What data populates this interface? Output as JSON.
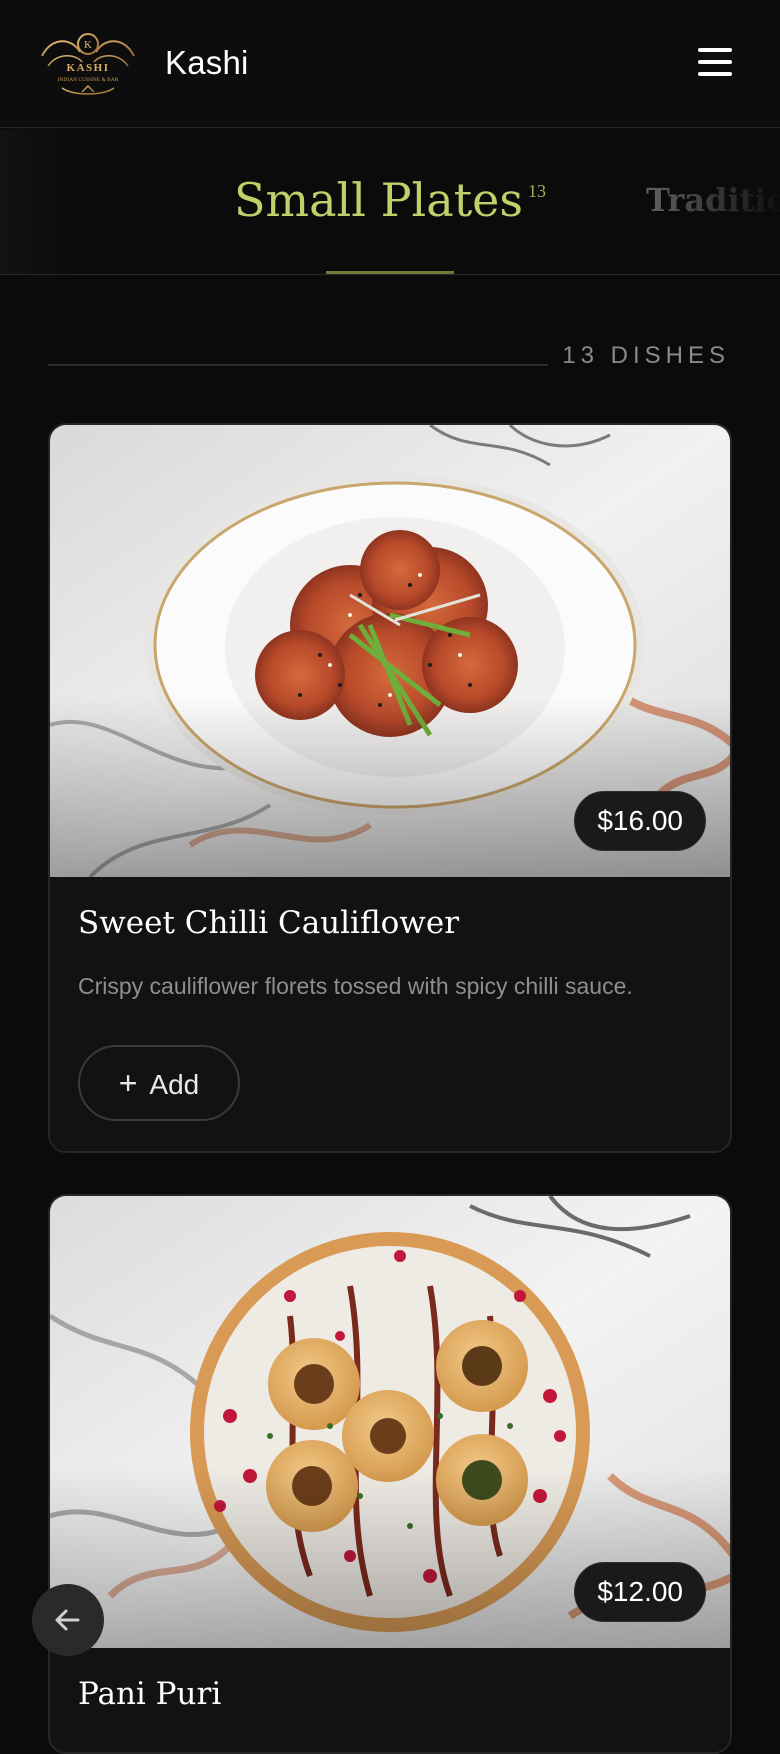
{
  "header": {
    "brand": "Kashi",
    "logo_text": "KASHI",
    "logo_subtext": "INDIAN CUISINE & BAR",
    "logo_monogram": "K",
    "menu_icon": "hamburger-icon"
  },
  "tabs": {
    "active_label": "Small Plates",
    "active_count": "13",
    "next_label": "Traditional"
  },
  "section": {
    "dish_count": "13 DISHES"
  },
  "dishes": [
    {
      "name": "Sweet Chilli Cauliflower",
      "description": "Crispy cauliflower florets tossed with spicy chilli sauce.",
      "price": "$16.00",
      "add_label": "Add"
    },
    {
      "name": "Pani Puri",
      "price": "$12.00"
    }
  ],
  "colors": {
    "accent": "#c2cf6a",
    "background": "#0b0b0b",
    "card": "#121212"
  },
  "nav": {
    "back_icon": "arrow-left-icon"
  }
}
